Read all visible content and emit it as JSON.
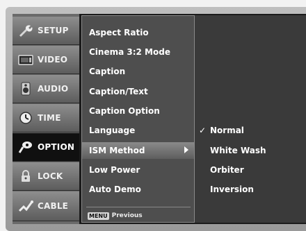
{
  "sidebar": {
    "tabs": [
      {
        "label": "SETUP",
        "icon": "setup-icon",
        "active": false
      },
      {
        "label": "VIDEO",
        "icon": "video-icon",
        "active": false
      },
      {
        "label": "AUDIO",
        "icon": "audio-icon",
        "active": false
      },
      {
        "label": "TIME",
        "icon": "time-icon",
        "active": false
      },
      {
        "label": "OPTION",
        "icon": "option-icon",
        "active": true
      },
      {
        "label": "LOCK",
        "icon": "lock-icon",
        "active": false
      },
      {
        "label": "CABLE",
        "icon": "cable-icon",
        "active": false
      }
    ]
  },
  "menu": {
    "items": [
      {
        "label": "Aspect Ratio"
      },
      {
        "label": "Cinema 3:2 Mode"
      },
      {
        "label": "Caption"
      },
      {
        "label": "Caption/Text"
      },
      {
        "label": "Caption Option"
      },
      {
        "label": "Language"
      },
      {
        "label": "ISM Method",
        "highlighted": true
      },
      {
        "label": "Low Power"
      },
      {
        "label": "Auto Demo"
      }
    ],
    "footer": {
      "key_label": "MENU",
      "action_label": "Previous"
    }
  },
  "options": {
    "items": [
      {
        "label": "Normal",
        "selected": true,
        "check": "✓"
      },
      {
        "label": "White Wash",
        "selected": false
      },
      {
        "label": "Orbiter",
        "selected": false
      },
      {
        "label": "Inversion",
        "selected": false
      }
    ]
  },
  "colors": {
    "frame": "#a8a8a8",
    "menu_bg": "#4e4e4e",
    "options_bg": "#3a3a3a",
    "active_tab": "#101010",
    "text": "#ffffff"
  }
}
